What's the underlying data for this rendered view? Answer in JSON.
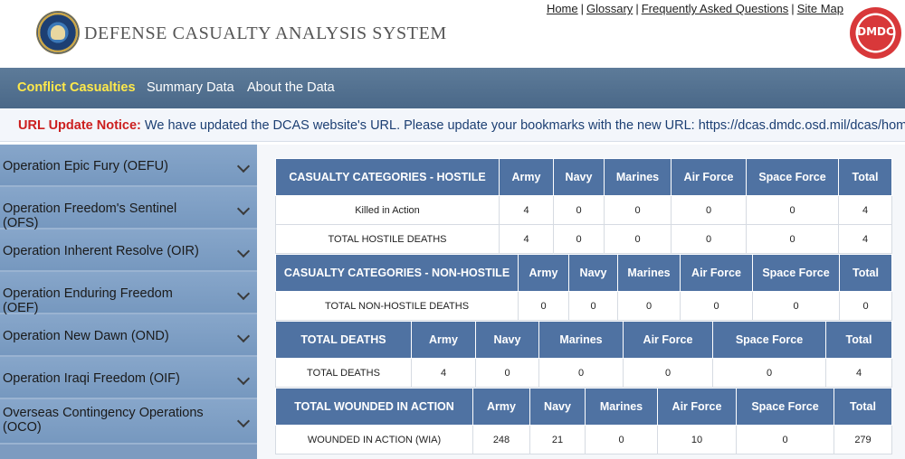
{
  "header": {
    "site_title": "DEFENSE CASUALTY ANALYSIS SYSTEM",
    "links": [
      "Home",
      "Glossary",
      "Frequently Asked Questions",
      "Site Map"
    ],
    "badge_text": "DMDC"
  },
  "nav": {
    "items": [
      "Conflict Casualties",
      "Summary Data",
      "About the Data"
    ]
  },
  "notice": {
    "label": "URL Update Notice:",
    "text": "We have updated the DCAS website's URL. Please update your bookmarks with the new URL: https://dcas.dmdc.osd.mil/dcas/home"
  },
  "sidebar": {
    "items": [
      "Operation Epic Fury (OEFU)",
      "Operation Freedom's Sentinel (OFS)",
      "Operation Inherent Resolve (OIR)",
      "Operation Enduring Freedom (OEF)",
      "Operation New Dawn (OND)",
      "Operation Iraqi Freedom (OIF)",
      "Overseas Contingency Operations (OCO)"
    ]
  },
  "tables": {
    "hostile": {
      "headers": [
        "CASUALTY CATEGORIES - HOSTILE",
        "Army",
        "Navy",
        "Marines",
        "Air Force",
        "Space Force",
        "Total"
      ],
      "rows": [
        [
          "Killed in Action",
          "4",
          "0",
          "0",
          "0",
          "0",
          "4"
        ],
        [
          "TOTAL HOSTILE DEATHS",
          "4",
          "0",
          "0",
          "0",
          "0",
          "4"
        ]
      ]
    },
    "non_hostile": {
      "headers": [
        "CASUALTY CATEGORIES - NON-HOSTILE",
        "Army",
        "Navy",
        "Marines",
        "Air Force",
        "Space Force",
        "Total"
      ],
      "rows": [
        [
          "TOTAL NON-HOSTILE DEATHS",
          "0",
          "0",
          "0",
          "0",
          "0",
          "0"
        ]
      ]
    },
    "total_deaths": {
      "headers": [
        "TOTAL DEATHS",
        "Army",
        "Navy",
        "Marines",
        "Air Force",
        "Space Force",
        "Total"
      ],
      "rows": [
        [
          "TOTAL DEATHS",
          "4",
          "0",
          "0",
          "0",
          "0",
          "4"
        ]
      ]
    },
    "wounded": {
      "headers": [
        "TOTAL WOUNDED IN ACTION",
        "Army",
        "Navy",
        "Marines",
        "Air Force",
        "Space Force",
        "Total"
      ],
      "rows": [
        [
          "WOUNDED IN ACTION (WIA)",
          "248",
          "21",
          "0",
          "10",
          "0",
          "279"
        ]
      ]
    }
  },
  "colors": {
    "nav_active": "#ffe94a",
    "table_header": "#4f72a2",
    "sidebar": "#7d9bc0",
    "notice_label": "#cc1f1f"
  }
}
